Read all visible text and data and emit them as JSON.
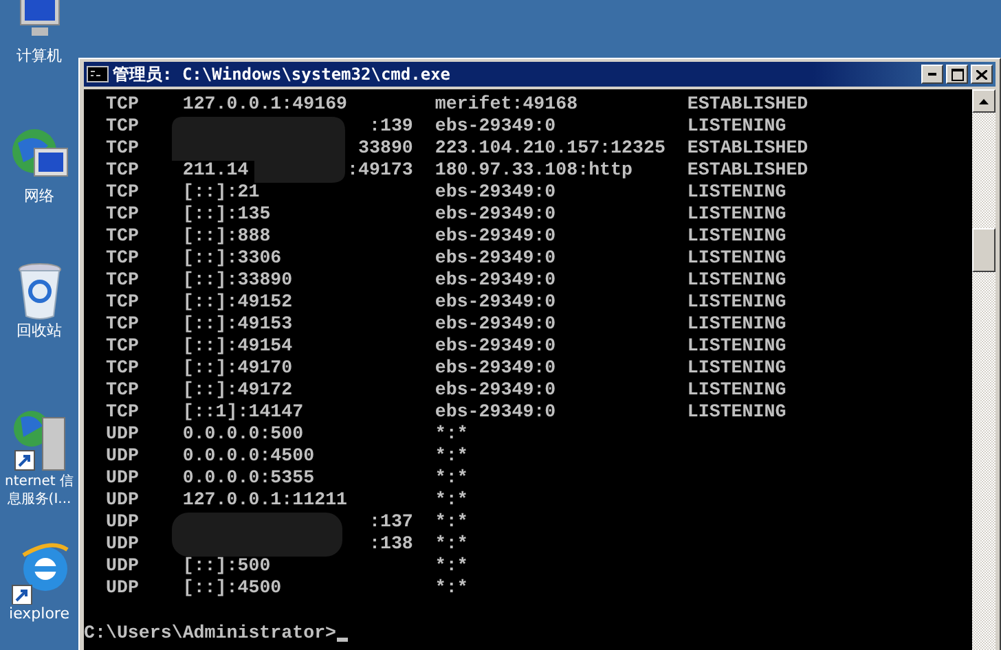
{
  "desktop_icons": [
    {
      "label": "计算机",
      "kind": "computer"
    },
    {
      "label": "网络",
      "kind": "network"
    },
    {
      "label": "回收站",
      "kind": "recycle"
    },
    {
      "label": "nternet 信息服务(I...",
      "kind": "server"
    },
    {
      "label": "iexplore",
      "kind": "browser"
    }
  ],
  "window": {
    "title": "管理员: C:\\Windows\\system32\\cmd.exe"
  },
  "rows": [
    {
      "proto": "TCP",
      "local": "127.0.0.1:49169",
      "foreign": "merifet:49168",
      "state": "ESTABLISHED"
    },
    {
      "proto": "TCP",
      "local_tail": ":139",
      "foreign": "ebs-29349:0",
      "state": "LISTENING"
    },
    {
      "proto": "TCP",
      "local_tail": "33890",
      "foreign": "223.104.210.157:12325",
      "state": "ESTABLISHED"
    },
    {
      "proto": "TCP",
      "local": "211.14",
      "local_tail": ":49173",
      "foreign": "180.97.33.108:http",
      "state": "ESTABLISHED"
    },
    {
      "proto": "TCP",
      "local": "[::]:21",
      "foreign": "ebs-29349:0",
      "state": "LISTENING"
    },
    {
      "proto": "TCP",
      "local": "[::]:135",
      "foreign": "ebs-29349:0",
      "state": "LISTENING"
    },
    {
      "proto": "TCP",
      "local": "[::]:888",
      "foreign": "ebs-29349:0",
      "state": "LISTENING"
    },
    {
      "proto": "TCP",
      "local": "[::]:3306",
      "foreign": "ebs-29349:0",
      "state": "LISTENING"
    },
    {
      "proto": "TCP",
      "local": "[::]:33890",
      "foreign": "ebs-29349:0",
      "state": "LISTENING"
    },
    {
      "proto": "TCP",
      "local": "[::]:49152",
      "foreign": "ebs-29349:0",
      "state": "LISTENING"
    },
    {
      "proto": "TCP",
      "local": "[::]:49153",
      "foreign": "ebs-29349:0",
      "state": "LISTENING"
    },
    {
      "proto": "TCP",
      "local": "[::]:49154",
      "foreign": "ebs-29349:0",
      "state": "LISTENING"
    },
    {
      "proto": "TCP",
      "local": "[::]:49170",
      "foreign": "ebs-29349:0",
      "state": "LISTENING"
    },
    {
      "proto": "TCP",
      "local": "[::]:49172",
      "foreign": "ebs-29349:0",
      "state": "LISTENING"
    },
    {
      "proto": "TCP",
      "local": "[::1]:14147",
      "foreign": "ebs-29349:0",
      "state": "LISTENING"
    },
    {
      "proto": "UDP",
      "local": "0.0.0.0:500",
      "foreign": "*:*"
    },
    {
      "proto": "UDP",
      "local": "0.0.0.0:4500",
      "foreign": "*:*"
    },
    {
      "proto": "UDP",
      "local": "0.0.0.0:5355",
      "foreign": "*:*"
    },
    {
      "proto": "UDP",
      "local": "127.0.0.1:11211",
      "foreign": "*:*"
    },
    {
      "proto": "UDP",
      "local_tail": ":137",
      "foreign": "*:*"
    },
    {
      "proto": "UDP",
      "local_tail": ":138",
      "foreign": "*:*"
    },
    {
      "proto": "UDP",
      "local": "[::]:500",
      "foreign": "*:*"
    },
    {
      "proto": "UDP",
      "local": "[::]:4500",
      "foreign": "*:*"
    }
  ],
  "prompt": "C:\\Users\\Administrator>"
}
